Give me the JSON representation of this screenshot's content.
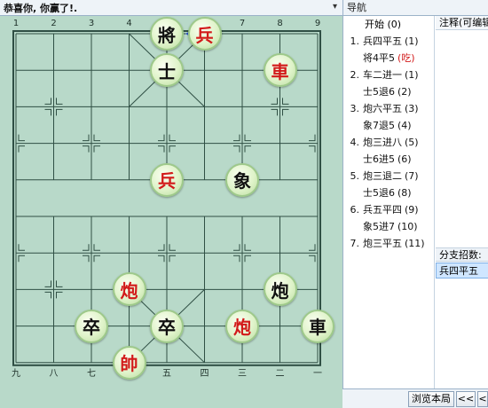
{
  "window": {
    "title": "恭喜你, 你赢了!.",
    "menu_icon": "▾"
  },
  "board": {
    "top_coords": [
      "1",
      "2",
      "3",
      "4",
      "5",
      "6",
      "7",
      "8",
      "9"
    ],
    "bottom_coords": [
      "九",
      "八",
      "七",
      "六",
      "五",
      "四",
      "三",
      "二",
      "一"
    ],
    "pieces": [
      {
        "char": "將",
        "side": "black",
        "file": 4,
        "rank": 0
      },
      {
        "char": "兵",
        "side": "red",
        "file": 5,
        "rank": 0
      },
      {
        "char": "士",
        "side": "black",
        "file": 4,
        "rank": 1
      },
      {
        "char": "車",
        "side": "red",
        "file": 7,
        "rank": 1
      },
      {
        "char": "兵",
        "side": "red",
        "file": 4,
        "rank": 4
      },
      {
        "char": "象",
        "side": "black",
        "file": 6,
        "rank": 4
      },
      {
        "char": "炮",
        "side": "red",
        "file": 3,
        "rank": 7
      },
      {
        "char": "炮",
        "side": "black",
        "file": 7,
        "rank": 7
      },
      {
        "char": "卒",
        "side": "black",
        "file": 2,
        "rank": 8
      },
      {
        "char": "卒",
        "side": "black",
        "file": 4,
        "rank": 8
      },
      {
        "char": "炮",
        "side": "red",
        "file": 6,
        "rank": 8
      },
      {
        "char": "車",
        "side": "black",
        "file": 8,
        "rank": 8
      },
      {
        "char": "帥",
        "side": "red",
        "file": 3,
        "rank": 9
      }
    ],
    "last_move_arrow": {
      "from_file": 5,
      "from_rank": 0,
      "to_file": 4,
      "to_rank": 0,
      "color": "#2a54c8"
    }
  },
  "nav": {
    "title": "导航",
    "start_label": "开始 (0)",
    "moves": [
      {
        "num": "1.",
        "text": "兵四平五",
        "idx": "(1)"
      },
      {
        "num": "",
        "text": "将4平5",
        "idx": "(吃)",
        "capture": true
      },
      {
        "num": "2.",
        "text": "车二进一",
        "idx": "(1)"
      },
      {
        "num": "",
        "text": "士5退6",
        "idx": "(2)"
      },
      {
        "num": "3.",
        "text": "炮六平五",
        "idx": "(3)"
      },
      {
        "num": "",
        "text": "象7退5",
        "idx": "(4)"
      },
      {
        "num": "4.",
        "text": "炮三进八",
        "idx": "(5)"
      },
      {
        "num": "",
        "text": "士6进5",
        "idx": "(6)"
      },
      {
        "num": "5.",
        "text": "炮三退二",
        "idx": "(7)"
      },
      {
        "num": "",
        "text": "士5退6",
        "idx": "(8)"
      },
      {
        "num": "6.",
        "text": "兵五平四",
        "idx": "(9)"
      },
      {
        "num": "",
        "text": "象5进7",
        "idx": "(10)"
      },
      {
        "num": "7.",
        "text": "炮三平五",
        "idx": "(11)"
      }
    ],
    "comment_label": "注释(可编辑",
    "branch_label": "分支招数:",
    "branch_item": "兵四平五",
    "browse_button": "浏览本局",
    "prev_button": "<<",
    "more_button": "<"
  },
  "colors": {
    "board_bg": "#b8d9c9",
    "line": "#2f4f44",
    "red": "#d21a1a",
    "black": "#111111"
  }
}
